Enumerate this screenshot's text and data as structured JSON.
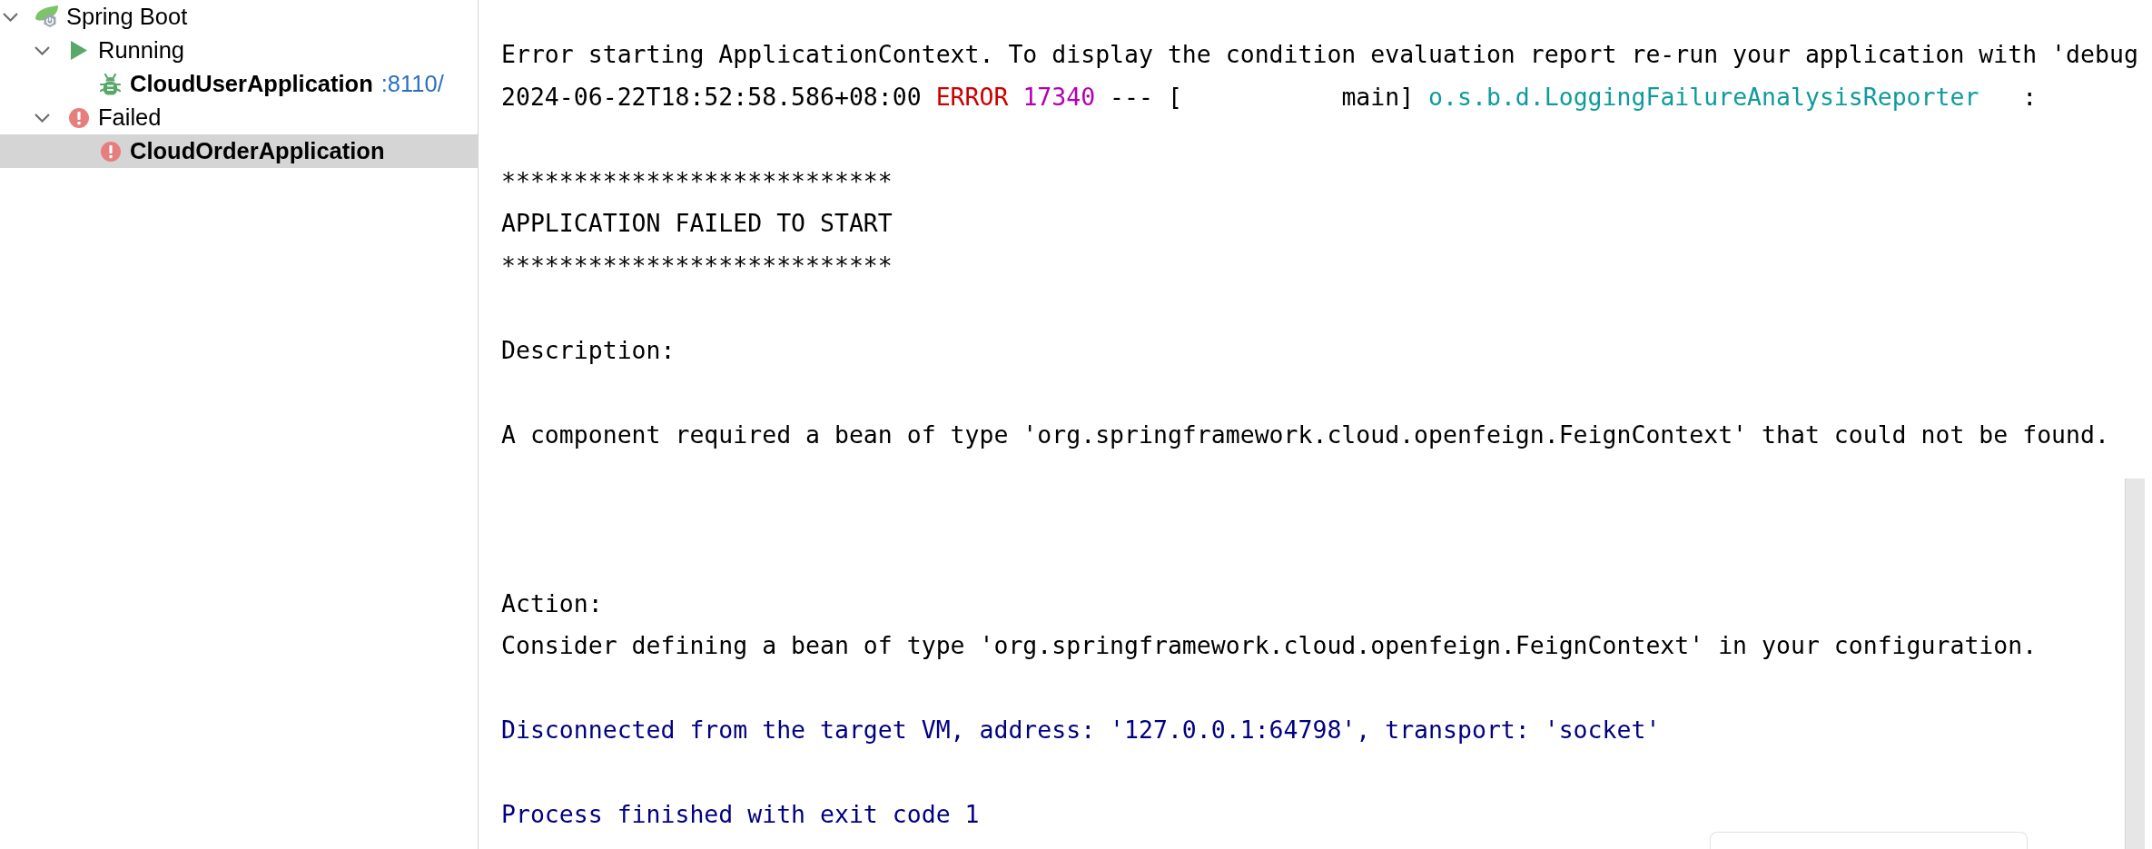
{
  "services_tree": {
    "nodes": [
      {
        "label": "Spring Boot",
        "kind": "root",
        "expanded": true,
        "selected": false,
        "children": [
          {
            "label": "Running",
            "kind": "group",
            "failed": false,
            "expanded": true,
            "selected": false,
            "children": [
              {
                "label": "CloudUserApplication",
                "kind": "app",
                "failed": false,
                "port": ":8110/",
                "selected": false
              }
            ]
          },
          {
            "label": "Failed",
            "kind": "group",
            "failed": true,
            "expanded": true,
            "selected": false,
            "children": [
              {
                "label": "CloudOrderApplication",
                "kind": "app",
                "failed": true,
                "selected": true
              }
            ]
          }
        ]
      }
    ]
  },
  "console": {
    "lines": [
      {
        "kind": "plain",
        "text": "Error starting ApplicationContext. To display the condition evaluation report re-run your application with 'debug"
      },
      {
        "kind": "log",
        "segments": [
          {
            "kind": "timestamp",
            "text": "2024-06-22T18:52:58.586+08:00"
          },
          {
            "kind": "level",
            "text": "ERROR"
          },
          {
            "kind": "pid",
            "text": "17340"
          },
          {
            "kind": "thread",
            "text": "--- [           main]"
          },
          {
            "kind": "logger",
            "text": "o.s.b.d.LoggingFailureAnalysisReporter"
          },
          {
            "kind": "separator",
            "text": ":"
          }
        ]
      },
      {
        "kind": "blank"
      },
      {
        "kind": "plain",
        "text": "***************************"
      },
      {
        "kind": "plain",
        "text": "APPLICATION FAILED TO START"
      },
      {
        "kind": "plain",
        "text": "***************************"
      },
      {
        "kind": "blank"
      },
      {
        "kind": "plain",
        "text": "Description:"
      },
      {
        "kind": "blank"
      },
      {
        "kind": "plain",
        "text": "A component required a bean of type 'org.springframework.cloud.openfeign.FeignContext' that could not be found."
      },
      {
        "kind": "blank"
      },
      {
        "kind": "blank"
      },
      {
        "kind": "blank"
      },
      {
        "kind": "plain",
        "text": "Action:"
      },
      {
        "kind": "plain",
        "text": "Consider defining a bean of type 'org.springframework.cloud.openfeign.FeignContext' in your configuration."
      },
      {
        "kind": "blank"
      },
      {
        "kind": "system",
        "text": "Disconnected from the target VM, address: '127.0.0.1:64798', transport: 'socket'"
      },
      {
        "kind": "blank"
      },
      {
        "kind": "system",
        "text": "Process finished with exit code 1"
      }
    ]
  }
}
